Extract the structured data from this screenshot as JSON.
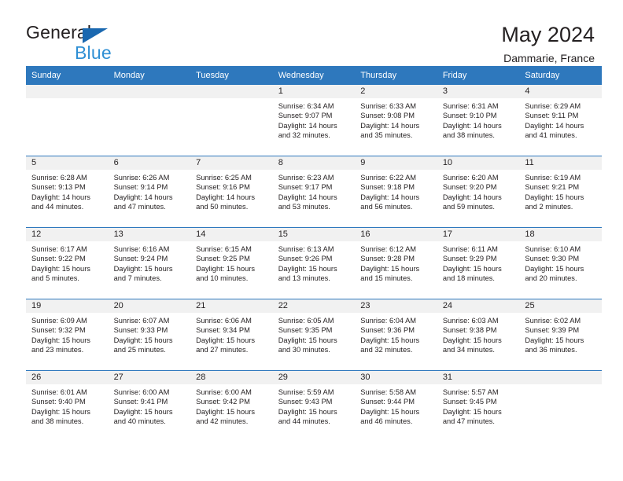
{
  "brand": {
    "word1": "General",
    "word2": "Blue",
    "accent_color": "#1a68b0",
    "blue_text_color": "#2f8fd4"
  },
  "header": {
    "title": "May 2024",
    "subtitle": "Dammarie, France"
  },
  "calendar": {
    "header_bg": "#2e78bd",
    "daynum_bg": "#f1f1f1",
    "weekday_headers": [
      "Sunday",
      "Monday",
      "Tuesday",
      "Wednesday",
      "Thursday",
      "Friday",
      "Saturday"
    ],
    "weeks": [
      [
        {
          "day": "",
          "sunrise": "",
          "sunset": "",
          "daylight1": "",
          "daylight2": "",
          "empty": true
        },
        {
          "day": "",
          "sunrise": "",
          "sunset": "",
          "daylight1": "",
          "daylight2": "",
          "empty": true
        },
        {
          "day": "",
          "sunrise": "",
          "sunset": "",
          "daylight1": "",
          "daylight2": "",
          "empty": true
        },
        {
          "day": "1",
          "sunrise": "Sunrise: 6:34 AM",
          "sunset": "Sunset: 9:07 PM",
          "daylight1": "Daylight: 14 hours",
          "daylight2": "and 32 minutes."
        },
        {
          "day": "2",
          "sunrise": "Sunrise: 6:33 AM",
          "sunset": "Sunset: 9:08 PM",
          "daylight1": "Daylight: 14 hours",
          "daylight2": "and 35 minutes."
        },
        {
          "day": "3",
          "sunrise": "Sunrise: 6:31 AM",
          "sunset": "Sunset: 9:10 PM",
          "daylight1": "Daylight: 14 hours",
          "daylight2": "and 38 minutes."
        },
        {
          "day": "4",
          "sunrise": "Sunrise: 6:29 AM",
          "sunset": "Sunset: 9:11 PM",
          "daylight1": "Daylight: 14 hours",
          "daylight2": "and 41 minutes."
        }
      ],
      [
        {
          "day": "5",
          "sunrise": "Sunrise: 6:28 AM",
          "sunset": "Sunset: 9:13 PM",
          "daylight1": "Daylight: 14 hours",
          "daylight2": "and 44 minutes."
        },
        {
          "day": "6",
          "sunrise": "Sunrise: 6:26 AM",
          "sunset": "Sunset: 9:14 PM",
          "daylight1": "Daylight: 14 hours",
          "daylight2": "and 47 minutes."
        },
        {
          "day": "7",
          "sunrise": "Sunrise: 6:25 AM",
          "sunset": "Sunset: 9:16 PM",
          "daylight1": "Daylight: 14 hours",
          "daylight2": "and 50 minutes."
        },
        {
          "day": "8",
          "sunrise": "Sunrise: 6:23 AM",
          "sunset": "Sunset: 9:17 PM",
          "daylight1": "Daylight: 14 hours",
          "daylight2": "and 53 minutes."
        },
        {
          "day": "9",
          "sunrise": "Sunrise: 6:22 AM",
          "sunset": "Sunset: 9:18 PM",
          "daylight1": "Daylight: 14 hours",
          "daylight2": "and 56 minutes."
        },
        {
          "day": "10",
          "sunrise": "Sunrise: 6:20 AM",
          "sunset": "Sunset: 9:20 PM",
          "daylight1": "Daylight: 14 hours",
          "daylight2": "and 59 minutes."
        },
        {
          "day": "11",
          "sunrise": "Sunrise: 6:19 AM",
          "sunset": "Sunset: 9:21 PM",
          "daylight1": "Daylight: 15 hours",
          "daylight2": "and 2 minutes."
        }
      ],
      [
        {
          "day": "12",
          "sunrise": "Sunrise: 6:17 AM",
          "sunset": "Sunset: 9:22 PM",
          "daylight1": "Daylight: 15 hours",
          "daylight2": "and 5 minutes."
        },
        {
          "day": "13",
          "sunrise": "Sunrise: 6:16 AM",
          "sunset": "Sunset: 9:24 PM",
          "daylight1": "Daylight: 15 hours",
          "daylight2": "and 7 minutes."
        },
        {
          "day": "14",
          "sunrise": "Sunrise: 6:15 AM",
          "sunset": "Sunset: 9:25 PM",
          "daylight1": "Daylight: 15 hours",
          "daylight2": "and 10 minutes."
        },
        {
          "day": "15",
          "sunrise": "Sunrise: 6:13 AM",
          "sunset": "Sunset: 9:26 PM",
          "daylight1": "Daylight: 15 hours",
          "daylight2": "and 13 minutes."
        },
        {
          "day": "16",
          "sunrise": "Sunrise: 6:12 AM",
          "sunset": "Sunset: 9:28 PM",
          "daylight1": "Daylight: 15 hours",
          "daylight2": "and 15 minutes."
        },
        {
          "day": "17",
          "sunrise": "Sunrise: 6:11 AM",
          "sunset": "Sunset: 9:29 PM",
          "daylight1": "Daylight: 15 hours",
          "daylight2": "and 18 minutes."
        },
        {
          "day": "18",
          "sunrise": "Sunrise: 6:10 AM",
          "sunset": "Sunset: 9:30 PM",
          "daylight1": "Daylight: 15 hours",
          "daylight2": "and 20 minutes."
        }
      ],
      [
        {
          "day": "19",
          "sunrise": "Sunrise: 6:09 AM",
          "sunset": "Sunset: 9:32 PM",
          "daylight1": "Daylight: 15 hours",
          "daylight2": "and 23 minutes."
        },
        {
          "day": "20",
          "sunrise": "Sunrise: 6:07 AM",
          "sunset": "Sunset: 9:33 PM",
          "daylight1": "Daylight: 15 hours",
          "daylight2": "and 25 minutes."
        },
        {
          "day": "21",
          "sunrise": "Sunrise: 6:06 AM",
          "sunset": "Sunset: 9:34 PM",
          "daylight1": "Daylight: 15 hours",
          "daylight2": "and 27 minutes."
        },
        {
          "day": "22",
          "sunrise": "Sunrise: 6:05 AM",
          "sunset": "Sunset: 9:35 PM",
          "daylight1": "Daylight: 15 hours",
          "daylight2": "and 30 minutes."
        },
        {
          "day": "23",
          "sunrise": "Sunrise: 6:04 AM",
          "sunset": "Sunset: 9:36 PM",
          "daylight1": "Daylight: 15 hours",
          "daylight2": "and 32 minutes."
        },
        {
          "day": "24",
          "sunrise": "Sunrise: 6:03 AM",
          "sunset": "Sunset: 9:38 PM",
          "daylight1": "Daylight: 15 hours",
          "daylight2": "and 34 minutes."
        },
        {
          "day": "25",
          "sunrise": "Sunrise: 6:02 AM",
          "sunset": "Sunset: 9:39 PM",
          "daylight1": "Daylight: 15 hours",
          "daylight2": "and 36 minutes."
        }
      ],
      [
        {
          "day": "26",
          "sunrise": "Sunrise: 6:01 AM",
          "sunset": "Sunset: 9:40 PM",
          "daylight1": "Daylight: 15 hours",
          "daylight2": "and 38 minutes."
        },
        {
          "day": "27",
          "sunrise": "Sunrise: 6:00 AM",
          "sunset": "Sunset: 9:41 PM",
          "daylight1": "Daylight: 15 hours",
          "daylight2": "and 40 minutes."
        },
        {
          "day": "28",
          "sunrise": "Sunrise: 6:00 AM",
          "sunset": "Sunset: 9:42 PM",
          "daylight1": "Daylight: 15 hours",
          "daylight2": "and 42 minutes."
        },
        {
          "day": "29",
          "sunrise": "Sunrise: 5:59 AM",
          "sunset": "Sunset: 9:43 PM",
          "daylight1": "Daylight: 15 hours",
          "daylight2": "and 44 minutes."
        },
        {
          "day": "30",
          "sunrise": "Sunrise: 5:58 AM",
          "sunset": "Sunset: 9:44 PM",
          "daylight1": "Daylight: 15 hours",
          "daylight2": "and 46 minutes."
        },
        {
          "day": "31",
          "sunrise": "Sunrise: 5:57 AM",
          "sunset": "Sunset: 9:45 PM",
          "daylight1": "Daylight: 15 hours",
          "daylight2": "and 47 minutes."
        },
        {
          "day": "",
          "sunrise": "",
          "sunset": "",
          "daylight1": "",
          "daylight2": "",
          "empty": true
        }
      ]
    ]
  }
}
